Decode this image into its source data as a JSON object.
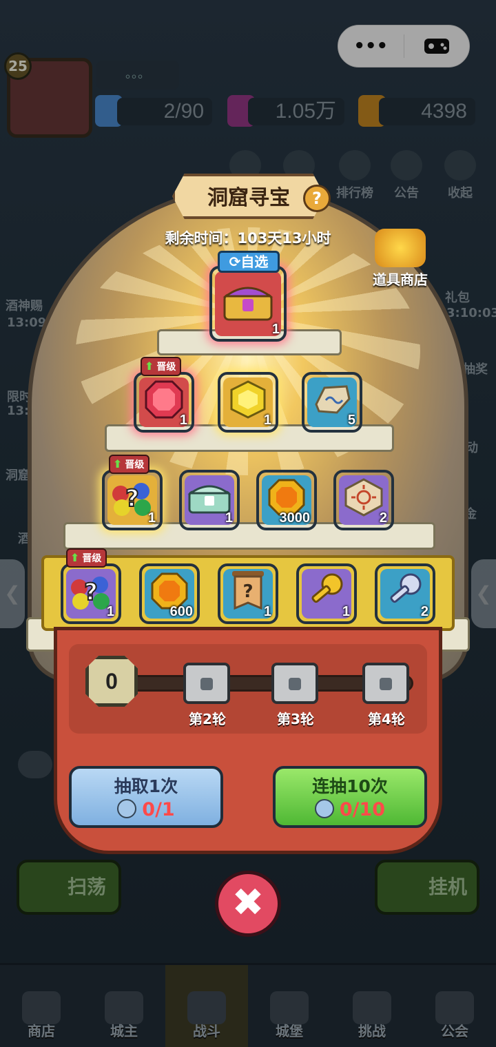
{
  "top_bar": {
    "more_icon": "•••",
    "game_icon": "gamepad-icon"
  },
  "player": {
    "level": "25",
    "name": "。。。"
  },
  "resources": [
    {
      "name": "energy",
      "value": "2/90"
    },
    {
      "name": "gems",
      "value": "1.05万"
    },
    {
      "name": "coins",
      "value": "4398"
    }
  ],
  "top_icons": {
    "rank": "排行榜",
    "notice": "公告",
    "collapse": "收起"
  },
  "side_left": {
    "item1": "酒神赐",
    "time1": "13:09:",
    "item2": "限时",
    "time2": "13:0",
    "item3": "洞窟",
    "item4": "酒"
  },
  "side_right": {
    "gift": "礼包",
    "gift_time": "3:10:03",
    "lottery": "抽奖",
    "act": "动",
    "fund": "金"
  },
  "panel": {
    "title": "洞窟寻宝",
    "help": "?",
    "remaining": "剩余时间：103天13小时",
    "shop_label": "道具商店",
    "select_label": "自选",
    "upgrade_label": "晋级"
  },
  "grand_prize": {
    "count": "1",
    "icon": "crown-chest-icon"
  },
  "tier2": [
    {
      "icon": "ruby-icon",
      "count": "1",
      "color": "red",
      "upgrade": true
    },
    {
      "icon": "topaz-icon",
      "count": "1",
      "color": "gold"
    },
    {
      "icon": "rune-stone-icon",
      "count": "5",
      "color": "blue"
    }
  ],
  "tier3": [
    {
      "icon": "mystery-gems-icon",
      "count": "1",
      "color": "gold",
      "upgrade": true
    },
    {
      "icon": "jade-chest-icon",
      "count": "1",
      "color": "purple"
    },
    {
      "icon": "coin-icon",
      "count": "3000",
      "color": "blue"
    },
    {
      "icon": "sun-rune-icon",
      "count": "2",
      "color": "purple"
    }
  ],
  "tier4": [
    {
      "icon": "mystery-gems-icon",
      "count": "1",
      "color": "purple",
      "upgrade": true
    },
    {
      "icon": "coin-icon",
      "count": "600",
      "color": "blue"
    },
    {
      "icon": "mystery-scroll-icon",
      "count": "1",
      "color": "blue"
    },
    {
      "icon": "gold-key-icon",
      "count": "1",
      "color": "purple"
    },
    {
      "icon": "silver-key-icon",
      "count": "2",
      "color": "blue"
    }
  ],
  "progress": {
    "current": "0",
    "rounds": [
      "第2轮",
      "第3轮",
      "第4轮"
    ]
  },
  "draw_buttons": {
    "single": {
      "label": "抽取1次",
      "cost": "0/1"
    },
    "ten": {
      "label": "连抽10次",
      "cost": "0/10"
    }
  },
  "close": "✖",
  "behind": {
    "sweep": "扫荡",
    "idle": "挂机"
  },
  "bottom_nav": [
    "商店",
    "城主",
    "战斗",
    "城堡",
    "挑战",
    "公会"
  ],
  "colors": {
    "accent_green": "#5fc83a",
    "accent_blue": "#8fc0ea",
    "close_red": "#e24a62"
  }
}
